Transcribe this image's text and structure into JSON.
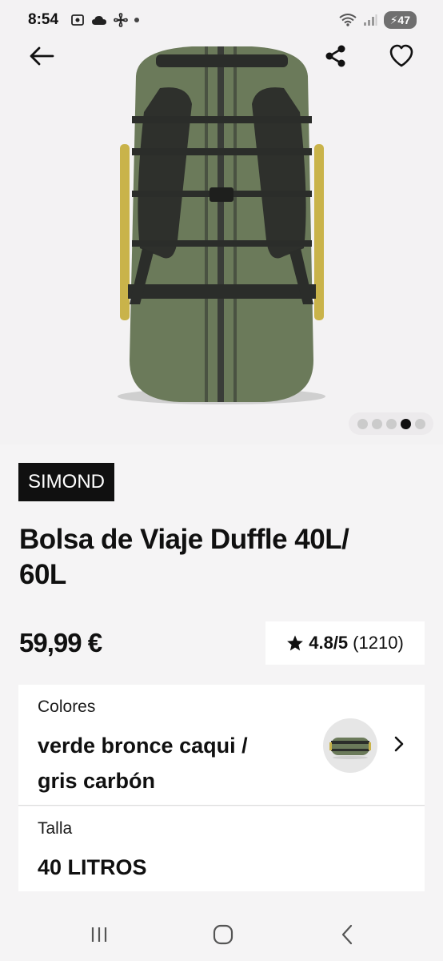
{
  "status_bar": {
    "time": "8:54",
    "battery": "47"
  },
  "product": {
    "brand": "SIMOND",
    "title_line1": "Bolsa de Viaje Duffle 40L/",
    "title_line2": "60L",
    "price": "59,99 €",
    "rating_score": "4.8/5",
    "rating_count": "(1210)"
  },
  "gallery": {
    "total_images": 5,
    "active_index": 4
  },
  "options": {
    "color_label": "Colores",
    "color_value_line1": "verde bronce caqui /",
    "color_value_line2": "gris carbón",
    "size_label": "Talla",
    "size_value": "40 LITROS"
  },
  "colors": {
    "bag_green": "#6b7a5a",
    "bag_dark": "#3a3d38",
    "accent_yellow": "#c9b34a",
    "brand_bg": "#101010"
  }
}
